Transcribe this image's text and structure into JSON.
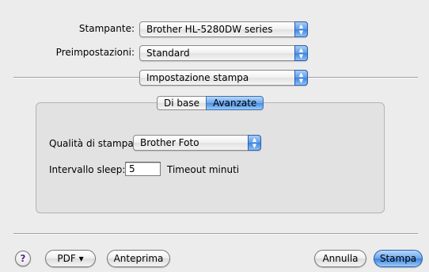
{
  "printer": {
    "label": "Stampante:",
    "value": "Brother HL-5280DW series"
  },
  "presets": {
    "label": "Preimpostazioni:",
    "value": "Standard"
  },
  "panel_menu": {
    "value": "Impostazione stampa"
  },
  "tabs": [
    {
      "label": "Di base",
      "active": false
    },
    {
      "label": "Avanzate",
      "active": true
    }
  ],
  "quality": {
    "label": "Qualità di stampa:",
    "value": "Brother Foto"
  },
  "sleep": {
    "label": "Intervallo sleep:",
    "value": "5",
    "suffix": "Timeout minuti"
  },
  "footer": {
    "help_label": "?",
    "pdf_label": "PDF ▾",
    "preview_label": "Anteprima",
    "cancel_label": "Annulla",
    "print_label": "Stampa"
  },
  "popup_arrows": {
    "up": "▲",
    "down": "▼"
  },
  "colors": {
    "accent": "#3d83df",
    "window_bg": "#ececec",
    "group_bg": "#e2e2e2"
  }
}
